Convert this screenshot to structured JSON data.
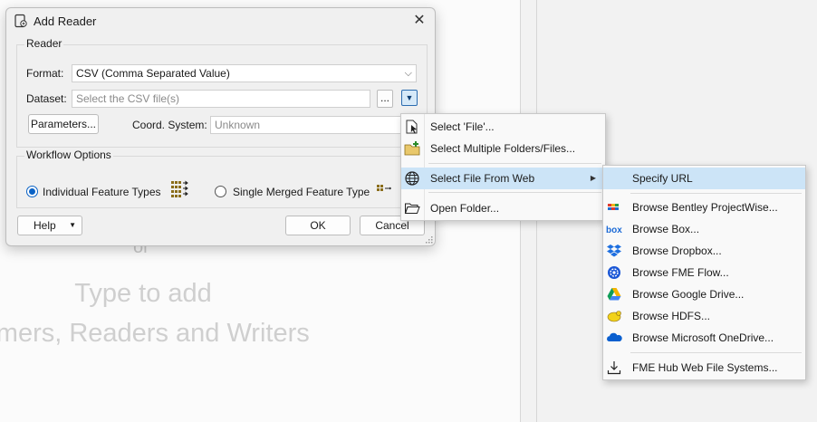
{
  "background": {
    "or_text": "or",
    "type_line1": "Type to add",
    "type_line2": "ormers, Readers and Writers"
  },
  "dialog": {
    "title": "Add Reader",
    "reader_group": {
      "label": "Reader",
      "format_label": "Format:",
      "format_value": "CSV (Comma Separated Value)",
      "dataset_label": "Dataset:",
      "dataset_placeholder": "Select the CSV file(s)",
      "browse_button": "...",
      "parameters_button": "Parameters...",
      "coord_label": "Coord. System:",
      "coord_placeholder": "Unknown"
    },
    "workflow_group": {
      "label": "Workflow Options",
      "option1": "Individual Feature Types",
      "option2": "Single Merged Feature Type",
      "selected": "Individual Feature Types"
    },
    "help_button": "Help",
    "ok_button": "OK",
    "cancel_button": "Cancel"
  },
  "menu_main": {
    "items": [
      {
        "label": "Select 'File'...",
        "icon": "file-cursor-icon"
      },
      {
        "label": "Select Multiple Folders/Files...",
        "icon": "folder-add-icon"
      },
      {
        "label": "Select File From Web",
        "icon": "globe-icon",
        "submenu": true,
        "highlighted": true
      },
      {
        "label": "Open Folder...",
        "icon": "folder-open-icon"
      }
    ]
  },
  "menu_web": {
    "items": [
      {
        "label": "Specify URL",
        "icon": "",
        "highlighted": true
      },
      {
        "label": "Browse Bentley ProjectWise...",
        "icon": "bentley-icon"
      },
      {
        "label": "Browse Box...",
        "icon": "box-icon"
      },
      {
        "label": "Browse Dropbox...",
        "icon": "dropbox-icon"
      },
      {
        "label": "Browse FME Flow...",
        "icon": "fme-flow-icon"
      },
      {
        "label": "Browse Google Drive...",
        "icon": "google-drive-icon"
      },
      {
        "label": "Browse HDFS...",
        "icon": "hdfs-icon"
      },
      {
        "label": "Browse Microsoft OneDrive...",
        "icon": "onedrive-icon"
      },
      {
        "label": "FME Hub Web File Systems...",
        "icon": "download-icon"
      }
    ]
  },
  "colors": {
    "highlight": "#cce4f7",
    "accent": "#0a62c5"
  }
}
